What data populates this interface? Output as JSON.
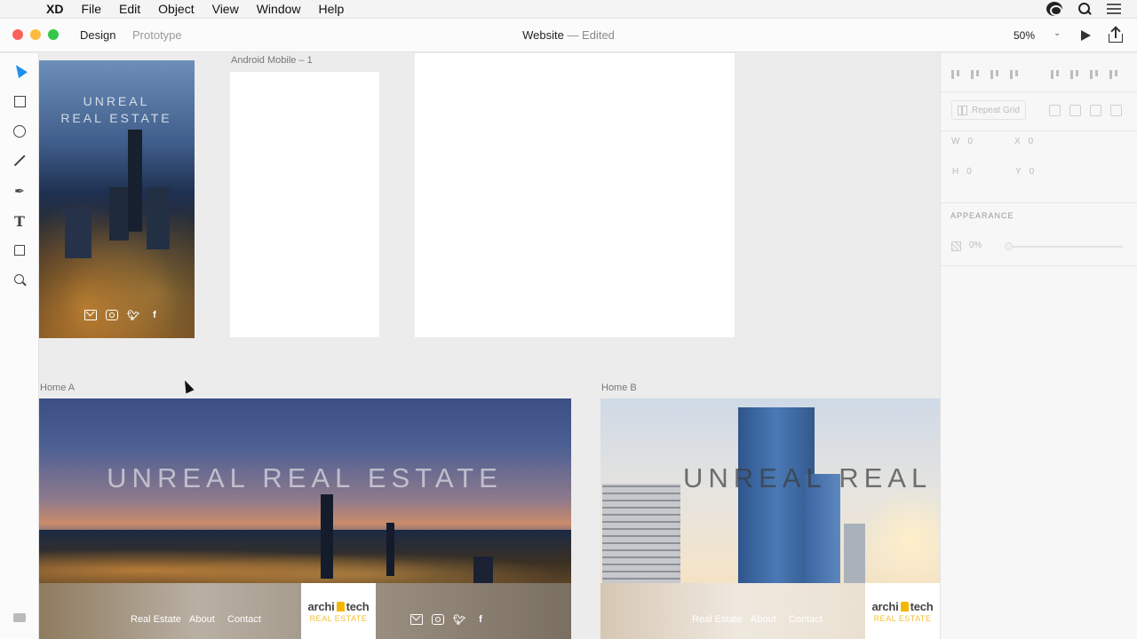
{
  "menubar": {
    "app_name": "XD",
    "items": [
      "File",
      "Edit",
      "Object",
      "View",
      "Window",
      "Help"
    ]
  },
  "titlebar": {
    "tabs": [
      "Design",
      "Prototype"
    ],
    "document_name": "Website",
    "document_status": "— Edited",
    "zoom": "50%"
  },
  "canvas": {
    "artboard_android": "Android Mobile – 1",
    "artboard_home_a": "Home A",
    "artboard_home_b": "Home B",
    "iphone_title_line1": "UNREAL",
    "iphone_title_line2": "REAL ESTATE",
    "home_a_title": "UNREAL REAL ESTATE",
    "home_b_title": "UNREAL REAL E",
    "footer_nav": [
      "Real Estate",
      "About",
      "Contact"
    ],
    "logo_main_left": "archi",
    "logo_main_right": "tech",
    "logo_sub": "REAL ESTATE"
  },
  "panel": {
    "repeat_grid": "Repeat Grid",
    "w_label": "W",
    "w_value": "0",
    "x_label": "X",
    "x_value": "0",
    "h_label": "H",
    "h_value": "0",
    "y_label": "Y",
    "y_value": "0",
    "appearance_label": "APPEARANCE",
    "opacity": "0%"
  },
  "colors": {
    "accent": "#1f8ef1",
    "logo_yellow": "#f2b705"
  }
}
